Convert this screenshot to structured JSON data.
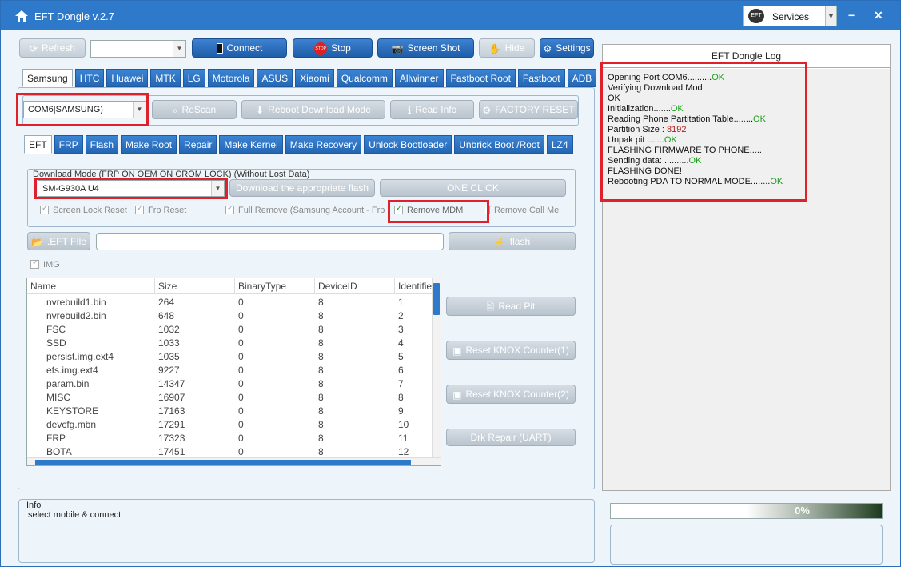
{
  "titlebar": {
    "title": "EFT Dongle  v.2.7",
    "services_label": "Services",
    "minimize": "−",
    "close": "✕"
  },
  "toolbar": {
    "refresh": "Refresh",
    "connect": "Connect",
    "stop": "Stop",
    "stop_badge": "STOP",
    "screenshot": "Screen Shot",
    "hide": "Hide",
    "settings": "Settings"
  },
  "brand_tabs": [
    "Samsung",
    "HTC",
    "Huawei",
    "MTK",
    "LG",
    "Motorola",
    "ASUS",
    "Xiaomi",
    "Qualcomm",
    "Allwinner",
    "Fastboot Root",
    "Fastboot",
    "ADB"
  ],
  "port": {
    "value": "COM6|SAMSUNG)",
    "rescan": "ReScan",
    "reboot": "Reboot  Download Mode",
    "read_info": "Read Info",
    "factory_reset": "FACTORY RESET"
  },
  "func_tabs": [
    "EFT",
    "FRP",
    "Flash",
    "Make Root",
    "Repair",
    "Make Kernel",
    "Make Recovery",
    "Unlock Bootloader",
    "Unbrick Boot /Root",
    "LZ4"
  ],
  "download_mode": {
    "legend": "Download Mode (FRP ON OEM ON CROM LOCK) (Without Lost Data)",
    "model": "SM-G930A  U4",
    "download_flash": "Download the appropriate flash",
    "one_click": "ONE CLICK",
    "checks": {
      "screen_lock": "Screen Lock  Reset",
      "frp_reset": "Frp Reset",
      "full_remove": "Full Remove (Samsung Account - Frp )",
      "remove_mdm": "Remove  MDM",
      "remove_call": "Remove Call Me"
    }
  },
  "file_row": {
    "eft_file": ".EFT FIle",
    "flash": "flash",
    "img": "IMG"
  },
  "grid": {
    "headers": [
      "Name",
      "Size",
      "BinaryType",
      "DeviceID",
      "Identifie"
    ],
    "rows": [
      [
        "nvrebuild1.bin",
        "264",
        "0",
        "8",
        "1"
      ],
      [
        "nvrebuild2.bin",
        "648",
        "0",
        "8",
        "2"
      ],
      [
        "FSC",
        "1032",
        "0",
        "8",
        "3"
      ],
      [
        "SSD",
        "1033",
        "0",
        "8",
        "4"
      ],
      [
        "persist.img.ext4",
        "1035",
        "0",
        "8",
        "5"
      ],
      [
        "efs.img.ext4",
        "9227",
        "0",
        "8",
        "6"
      ],
      [
        "param.bin",
        "14347",
        "0",
        "8",
        "7"
      ],
      [
        "MISC",
        "16907",
        "0",
        "8",
        "8"
      ],
      [
        "KEYSTORE",
        "17163",
        "0",
        "8",
        "9"
      ],
      [
        "devcfg.mbn",
        "17291",
        "0",
        "8",
        "10"
      ],
      [
        "FRP",
        "17323",
        "0",
        "8",
        "11"
      ],
      [
        "BOTA",
        "17451",
        "0",
        "8",
        "12"
      ]
    ]
  },
  "side_actions": {
    "read_pit": "Read Pit",
    "knox1": "Reset KNOX Counter(1)",
    "knox2": "Reset KNOX Counter(2)",
    "drk": "Drk Repair (UART)"
  },
  "log": {
    "title": "EFT Dongle Log",
    "lines": [
      {
        "text": "Opening Port COM6..........",
        "status": "OK"
      },
      {
        "text": "Verifying Download Mod",
        "status": ""
      },
      {
        "text": "OK",
        "status": ""
      },
      {
        "text": "Initialization.......",
        "status": "OK"
      },
      {
        "text": "Reading Phone Partitation Table........",
        "status": "OK"
      },
      {
        "text": "Partition Size : ",
        "value": "8192"
      },
      {
        "text": "Unpak pit .......",
        "status": "OK"
      },
      {
        "text": "FLASHING FIRMWARE TO PHONE.....",
        "status": ""
      },
      {
        "text": "Sending data: ..........",
        "status": "OK"
      },
      {
        "text": "FLASHING DONE!",
        "status": ""
      },
      {
        "text": "Rebooting PDA TO NORMAL MODE........",
        "status": "OK"
      }
    ]
  },
  "info": {
    "label": "Info",
    "message": "select mobile & connect"
  },
  "progress": {
    "percent": "0%",
    "value": 0
  }
}
